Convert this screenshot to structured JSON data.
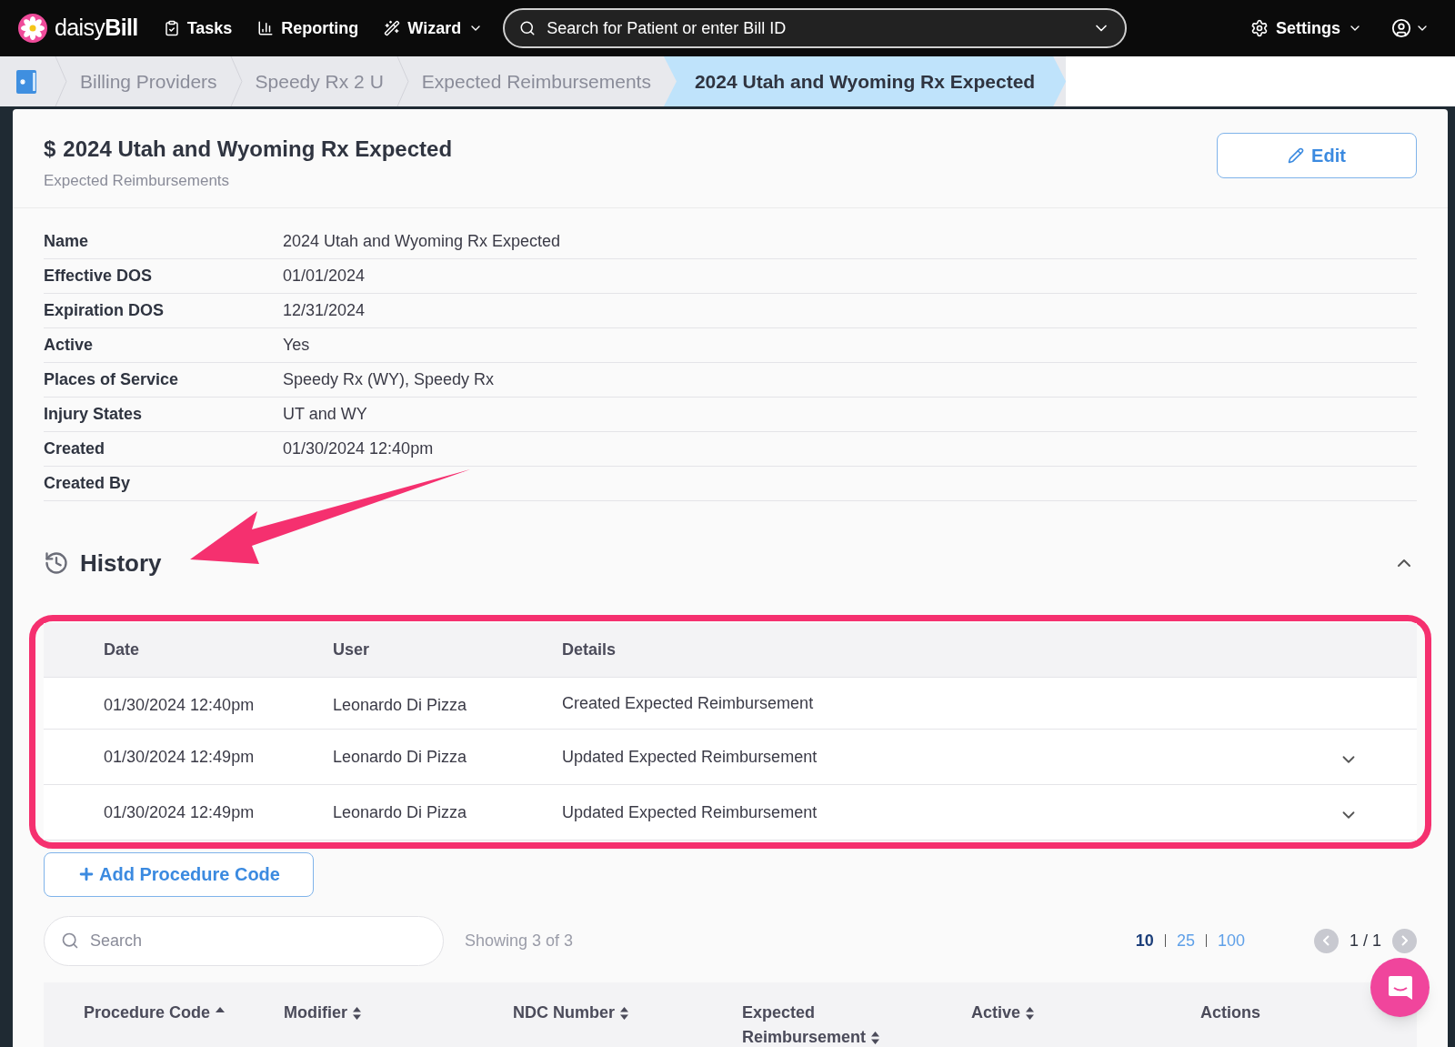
{
  "nav": {
    "logo": "daisy**Bill**",
    "items": [
      {
        "kind": "tasks",
        "label": "Tasks",
        "dropdown": false
      },
      {
        "kind": "reporting",
        "label": "Reporting",
        "dropdown": false
      },
      {
        "kind": "wizard",
        "label": "Wizard",
        "dropdown": true
      }
    ],
    "search": {
      "placeholder": "Search for Patient or enter Bill ID"
    },
    "settings": "Settings"
  },
  "breadcrumbs": [
    {
      "label": "Billing Providers",
      "selected": false
    },
    {
      "label": "Speedy Rx 2 U",
      "selected": false
    },
    {
      "label": "Expected Reimbursements",
      "selected": false
    },
    {
      "label": "2024 Utah and Wyoming Rx Expected",
      "selected": true
    }
  ],
  "header": {
    "symbol": "$",
    "title": "2024 Utah and Wyoming Rx Expected",
    "subtitle": "Expected Reimbursements",
    "edit_button": "Edit"
  },
  "details": [
    {
      "label": "Name",
      "value": "2024 Utah and Wyoming Rx Expected"
    },
    {
      "label": "Effective DOS",
      "value": "01/01/2024"
    },
    {
      "label": "Expiration DOS",
      "value": "12/31/2024"
    },
    {
      "label": "Active",
      "value": "Yes"
    },
    {
      "label": "Places of Service",
      "value": "Speedy Rx (WY), Speedy Rx"
    },
    {
      "label": "Injury States",
      "value": "UT and WY"
    },
    {
      "label": "Created",
      "value": "01/30/2024 12:40pm"
    },
    {
      "label": "Created By"
    }
  ],
  "history": {
    "title": "History",
    "expanded": true,
    "columns": [
      "Date",
      "User",
      "Details"
    ],
    "rows": [
      {
        "date": "01/30/2024 12:40pm",
        "user": "Leonardo Di Pizza",
        "details": "Created Expected Reimbursement",
        "expandable": false
      },
      {
        "date": "01/30/2024 12:49pm",
        "user": "Leonardo Di Pizza",
        "details": "Updated Expected Reimbursement",
        "expandable": true
      },
      {
        "date": "01/30/2024 12:49pm",
        "user": "Leonardo Di Pizza",
        "details": "Updated Expected Reimbursement",
        "expandable": true
      }
    ]
  },
  "add_button": "Add Procedure Code",
  "table_search": {
    "placeholder": "Search"
  },
  "showing": "Showing 3 of 3",
  "page_sizes": [
    {
      "label": "10",
      "selected": true
    },
    {
      "label": "25",
      "selected": false
    },
    {
      "label": "100",
      "selected": false
    }
  ],
  "page": "1 / 1",
  "columns": [
    {
      "label": "Procedure Code",
      "sortable": true,
      "sorted": true
    },
    {
      "label": "Modifier",
      "sortable": true,
      "sorted": false
    },
    {
      "label": "NDC Number",
      "sortable": true,
      "sorted": false
    },
    {
      "label": "Expected Reimbursement",
      "sortable": true,
      "sorted": false
    },
    {
      "label": "Active",
      "sortable": true,
      "sorted": false
    },
    {
      "label": "Actions",
      "sortable": false
    }
  ]
}
